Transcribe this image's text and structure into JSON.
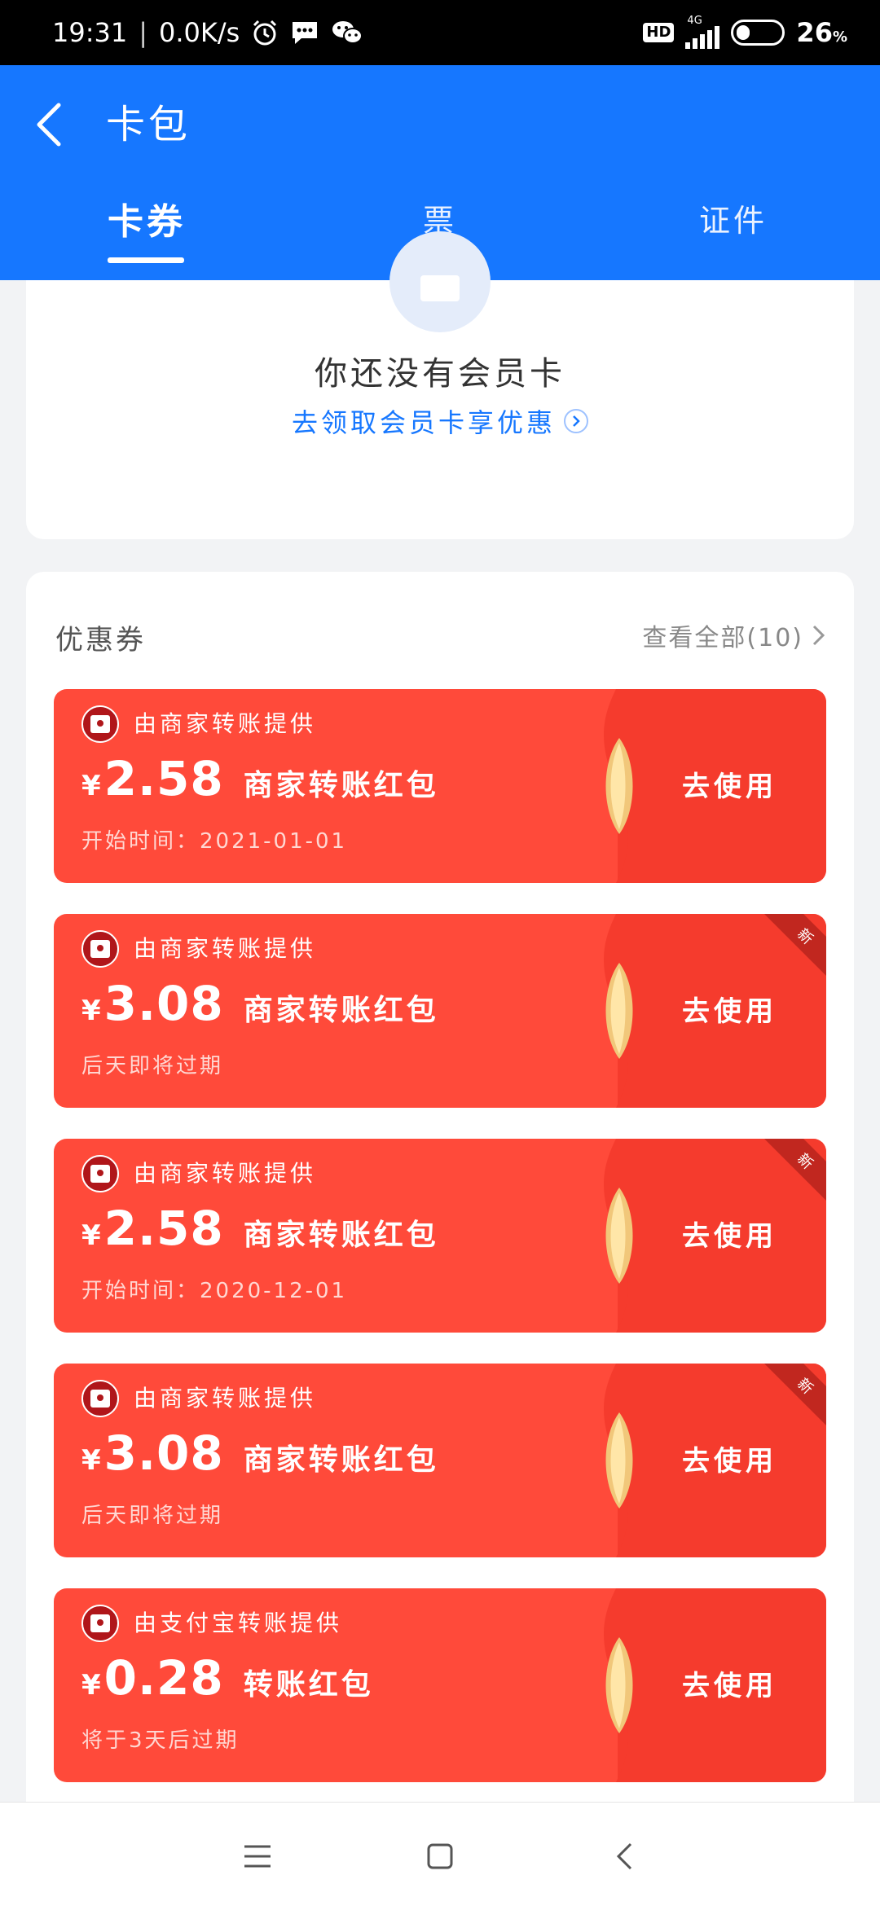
{
  "status_bar": {
    "time": "19:31",
    "net_speed": "0.0K/s",
    "icons": [
      "alarm-icon",
      "message-icon",
      "wechat-icon"
    ],
    "hd": "HD",
    "network": "4G",
    "battery": "26",
    "battery_unit": "%"
  },
  "header": {
    "title": "卡包",
    "tabs": [
      {
        "label": "卡券",
        "active": true
      },
      {
        "label": "票",
        "active": false
      },
      {
        "label": "证件",
        "active": false
      }
    ]
  },
  "member": {
    "title": "你还没有会员卡",
    "link": "去领取会员卡享优惠"
  },
  "coupons_section": {
    "title": "优惠券",
    "view_all": "查看全部(10)",
    "items": [
      {
        "provider": "由商家转账提供",
        "yen": "¥",
        "amount": "2.58",
        "title": "商家转账红包",
        "sub": "开始时间：2021-01-01",
        "action": "去使用",
        "is_new": false,
        "new_label": ""
      },
      {
        "provider": "由商家转账提供",
        "yen": "¥",
        "amount": "3.08",
        "title": "商家转账红包",
        "sub": "后天即将过期",
        "action": "去使用",
        "is_new": true,
        "new_label": "新"
      },
      {
        "provider": "由商家转账提供",
        "yen": "¥",
        "amount": "2.58",
        "title": "商家转账红包",
        "sub": "开始时间：2020-12-01",
        "action": "去使用",
        "is_new": true,
        "new_label": "新"
      },
      {
        "provider": "由商家转账提供",
        "yen": "¥",
        "amount": "3.08",
        "title": "商家转账红包",
        "sub": "后天即将过期",
        "action": "去使用",
        "is_new": true,
        "new_label": "新"
      },
      {
        "provider": "由支付宝转账提供",
        "yen": "¥",
        "amount": "0.28",
        "title": "转账红包",
        "sub": "将于3天后过期",
        "action": "去使用",
        "is_new": false,
        "new_label": ""
      }
    ]
  },
  "colors": {
    "header_blue": "#1677ff",
    "coupon_red": "#ff4a3a",
    "coupon_red_dark": "#f53b2d",
    "link_blue": "#1677ff"
  }
}
